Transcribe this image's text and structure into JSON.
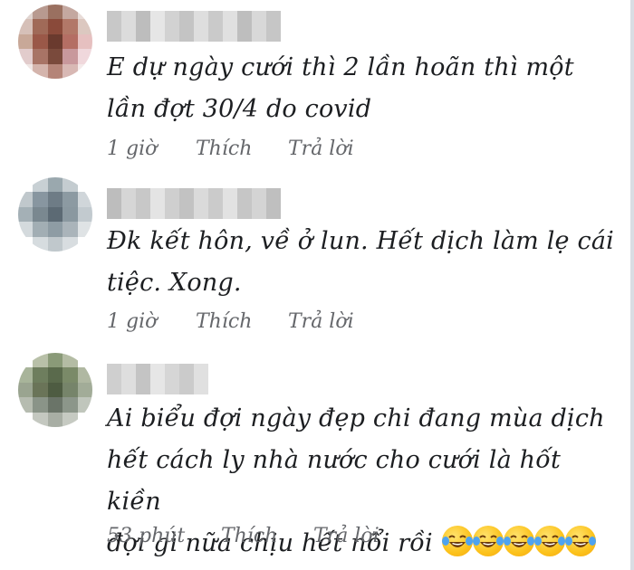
{
  "comments": [
    {
      "text": "E dự ngày cưới thì 2 lần hoãn thì một lần đợt 30/4 do covid",
      "time": "1 giờ",
      "like": "Thích",
      "reply": "Trả lời",
      "avatar_colors": [
        "#e0d4d0",
        "#b89a90",
        "#9a7060",
        "#c4a8a0",
        "#e8dcd8",
        "#d6c0b8",
        "#a06a58",
        "#8a4a3a",
        "#b27868",
        "#dcc8c0",
        "#c8a898",
        "#9a5848",
        "#6a3a2e",
        "#b46e64",
        "#e6c0c0",
        "#e2cccc",
        "#a87466",
        "#7a4a3c",
        "#c8989c",
        "#f0d8dc",
        "#f0e6e4",
        "#d4b4ac",
        "#b48478",
        "#d8b8b4",
        "#f4eaea"
      ],
      "name_colors": [
        "#c8c8c8",
        "#dcdcdc",
        "#bdbdbd",
        "#e6e6e6",
        "#d2d2d2",
        "#c4c4c4",
        "#dedede",
        "#cacaca",
        "#e0e0e0",
        "#bebebe",
        "#d8d8d8",
        "#c6c6c6"
      ]
    },
    {
      "text": "Đk kết hôn, về ở lun. Hết dịch làm lẹ cái tiệc. Xong.",
      "time": "1 giờ",
      "like": "Thích",
      "reply": "Trả lời",
      "avatar_colors": [
        "#ffffff",
        "#c8d0d4",
        "#9aa8ae",
        "#c4ccd0",
        "#ffffff",
        "#c0c8cc",
        "#8896a0",
        "#6e7c86",
        "#8c9aa2",
        "#d0d6da",
        "#a4b0b6",
        "#7a8890",
        "#5c6a74",
        "#8a98a0",
        "#c2cacf",
        "#d4dadd",
        "#a2aeb4",
        "#8e9ca4",
        "#aab4ba",
        "#dfe3e5",
        "#ffffff",
        "#d6dcdf",
        "#c0c8cc",
        "#d8dde0",
        "#ffffff"
      ],
      "name_colors": [
        "#bdbdbd",
        "#d6d6d6",
        "#c8c8c8",
        "#e4e4e4",
        "#cfcfcf",
        "#c2c2c2",
        "#dadada",
        "#cbcbcb",
        "#e2e2e2",
        "#c6c6c6",
        "#d4d4d4",
        "#bfbfbf"
      ]
    },
    {
      "text_lines": [
        "Ai biểu đợi ngày đẹp chi đang mùa dịch",
        "hết cách ly nhà nước cho cưới là hốt kiền",
        "đợi gì nữa chịu hết nổi rồi"
      ],
      "emoji_name": "face-with-tears-of-joy-icon",
      "emoji_count": 5,
      "time": "53 phút",
      "like": "Thích",
      "reply": "Trả lời",
      "avatar_colors": [
        "#ffffff",
        "#b8c0a8",
        "#8a9a78",
        "#b4bca4",
        "#ffffff",
        "#a8b49a",
        "#6e7e5e",
        "#5a6a4c",
        "#7a8a68",
        "#b0b8a2",
        "#9aa490",
        "#6a7458",
        "#4e5c42",
        "#76846a",
        "#a2ac98",
        "#b6bcb0",
        "#8a9488",
        "#6a7468",
        "#8c968a",
        "#c0c6bc",
        "#ffffff",
        "#c4c8c0",
        "#a8aea4",
        "#c6cac2",
        "#ffffff"
      ],
      "name_colors": [
        "#cfcfcf",
        "#dedede",
        "#c4c4c4",
        "#e6e6e6",
        "#d6d6d6",
        "#cbcbcb",
        "#e0e0e0"
      ]
    }
  ]
}
